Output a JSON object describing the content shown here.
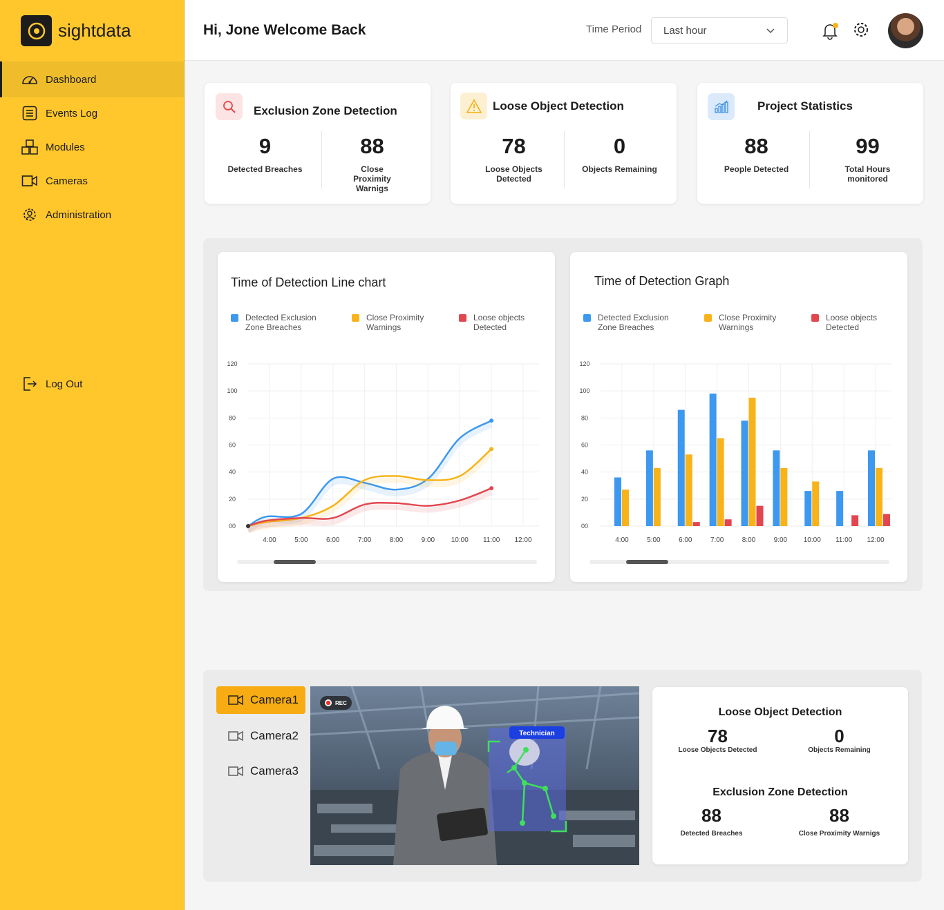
{
  "brand": {
    "name": "sightdata"
  },
  "sidebar": {
    "items": [
      {
        "label": "Dashboard",
        "icon": "dashboard-gauge-icon"
      },
      {
        "label": "Events Log",
        "icon": "list-icon"
      },
      {
        "label": "Modules",
        "icon": "cubes-icon"
      },
      {
        "label": "Cameras",
        "icon": "video-camera-icon"
      },
      {
        "label": "Administration",
        "icon": "admin-gear-user-icon"
      }
    ],
    "logout": "Log Out"
  },
  "header": {
    "greeting": "Hi, Jone Welcome Back",
    "time_period_label": "Time Period",
    "time_period_value": "Last hour"
  },
  "stats": [
    {
      "title": "Exclusion Zone Detection",
      "icon": "search-icon",
      "color": "#e64545",
      "a": {
        "value": "9",
        "label": "Detected Breaches"
      },
      "b": {
        "value": "88",
        "label": "Close Proximity Warnigs"
      }
    },
    {
      "title": "Loose Object Detection",
      "icon": "warning-icon",
      "color": "#f2b116",
      "a": {
        "value": "78",
        "label": "Loose Objects Detected"
      },
      "b": {
        "value": "0",
        "label": "Objects Remaining"
      }
    },
    {
      "title": "Project Statistics",
      "icon": "bar-chart-icon",
      "color": "#3b8fe0",
      "a": {
        "value": "88",
        "label": "People Detected"
      },
      "b": {
        "value": "99",
        "label": "Total Hours monitored"
      }
    }
  ],
  "legend": [
    {
      "label": "Detected Exclusion Zone Breaches",
      "color": "#3d98f0"
    },
    {
      "label": "Close Proximity Warnings",
      "color": "#f7b319"
    },
    {
      "label": "Loose objects Detected",
      "color": "#e2474f"
    }
  ],
  "chart_data": [
    {
      "type": "line",
      "title": "Time of Detection Line chart",
      "x": [
        "4:00",
        "5:00",
        "6:00",
        "7:00",
        "8:00",
        "9:00",
        "10:00",
        "11:00",
        "12:00"
      ],
      "y_ticks": [
        "00",
        "20",
        "40",
        "60",
        "80",
        "100",
        "120"
      ],
      "ylim": [
        0,
        120
      ],
      "series": [
        {
          "name": "Detected Exclusion Zone Breaches",
          "color": "#3d98f0",
          "values": [
            0,
            7,
            9,
            35,
            32,
            27,
            35,
            65,
            78
          ]
        },
        {
          "name": "Close Proximity Warnings",
          "color": "#f7b319",
          "values": [
            0,
            3,
            6,
            15,
            34,
            37,
            34,
            37,
            57
          ]
        },
        {
          "name": "Loose objects Detected",
          "color": "#e2474f",
          "values": [
            0,
            4,
            6,
            6,
            16,
            17,
            15,
            19,
            28
          ]
        }
      ]
    },
    {
      "type": "bar",
      "title": "Time of Detection Graph",
      "categories": [
        "4:00",
        "5:00",
        "6:00",
        "7:00",
        "8:00",
        "9:00",
        "10:00",
        "11:00",
        "12:00"
      ],
      "y_ticks": [
        "00",
        "20",
        "40",
        "60",
        "80",
        "100",
        "120"
      ],
      "ylim": [
        0,
        120
      ],
      "series": [
        {
          "name": "Detected Exclusion Zone Breaches",
          "color": "#3d98f0",
          "values": [
            36,
            56,
            86,
            98,
            78,
            56,
            26,
            26,
            56
          ]
        },
        {
          "name": "Close Proximity Warnings",
          "color": "#f7b319",
          "values": [
            27,
            43,
            53,
            65,
            95,
            43,
            33,
            0,
            43
          ]
        },
        {
          "name": "Loose objects Detected",
          "color": "#e2474f",
          "values": [
            0,
            0,
            3,
            5,
            15,
            0,
            0,
            8,
            9
          ]
        }
      ]
    }
  ],
  "cameras": {
    "items": [
      {
        "label": "Camera1"
      },
      {
        "label": "Camera2"
      },
      {
        "label": "Camera3"
      }
    ],
    "rec": "REC",
    "tag": "Technician"
  },
  "info": {
    "loose": {
      "title": "Loose Object Detection",
      "a": {
        "value": "78",
        "label": "Loose Objects Detected"
      },
      "b": {
        "value": "0",
        "label": "Objects Remaining"
      }
    },
    "exclusion": {
      "title": "Exclusion Zone Detection",
      "a": {
        "value": "88",
        "label": "Detected Breaches"
      },
      "b": {
        "value": "88",
        "label": "Close Proximity Warnigs"
      }
    }
  }
}
